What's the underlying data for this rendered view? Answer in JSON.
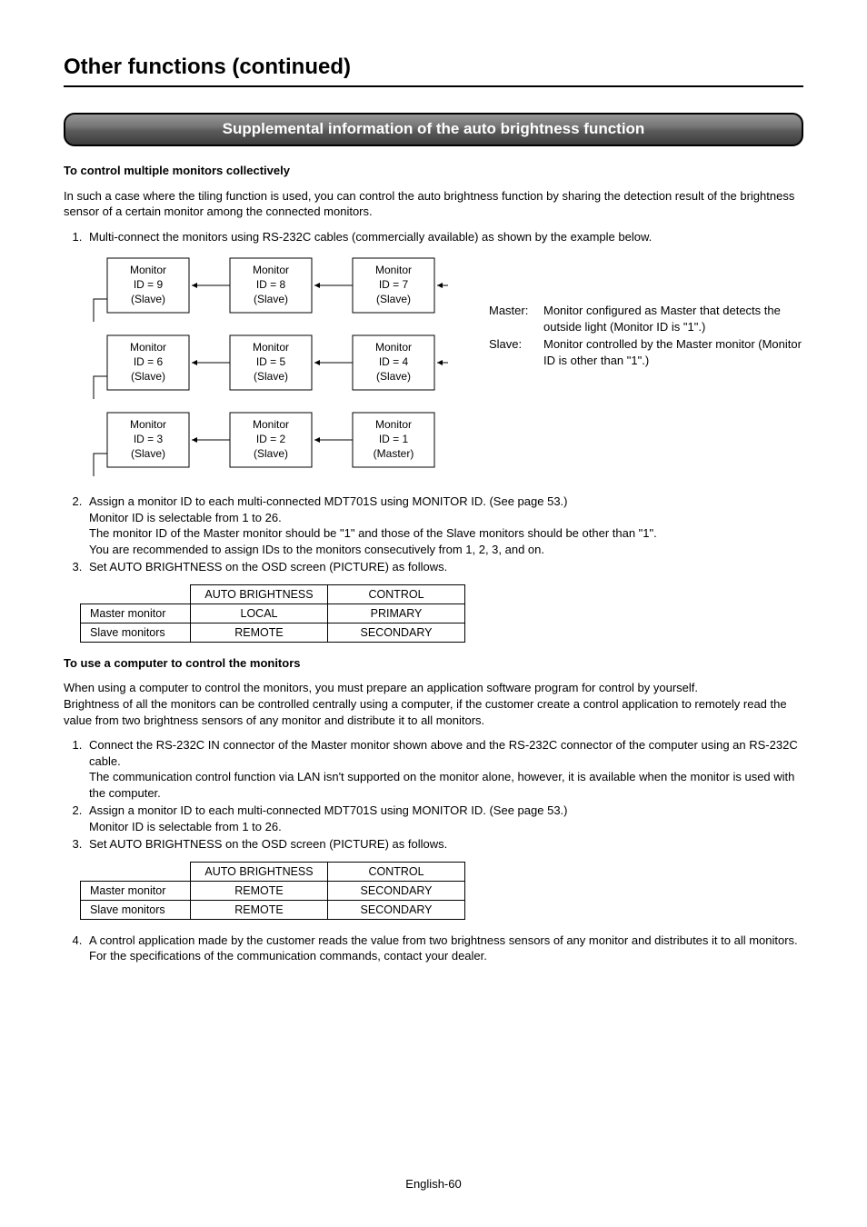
{
  "title": "Other functions (continued)",
  "banner": "Supplemental information of the auto brightness function",
  "sec1": {
    "heading": "To control multiple monitors collectively",
    "intro": "In such a case where the tiling function is used, you can control the auto brightness function by sharing the detection result of the brightness sensor of a certain monitor among the connected monitors.",
    "step1": "Multi-connect the monitors using RS-232C cables (commercially available) as shown by the example below.",
    "step2a": "Assign a monitor ID to each multi-connected MDT701S using MONITOR ID. (See page 53.)",
    "step2b": "Monitor ID is selectable from 1 to 26.",
    "step2c": "The monitor ID of the Master monitor should be \"1\" and those of the Slave monitors should be other than \"1\".",
    "step2d": "You are recommended to assign IDs to the monitors consecutively from 1, 2, 3, and on.",
    "step3": "Set AUTO BRIGHTNESS on the OSD screen (PICTURE) as follows."
  },
  "defs": {
    "master_label": "Master:",
    "master_text": "Monitor configured as Master that detects the outside light (Monitor ID is \"1\".)",
    "slave_label": "Slave:",
    "slave_text": "Monitor controlled by the Master monitor (Monitor ID is other than \"1\".)"
  },
  "diagram": {
    "boxes": [
      {
        "l1": "Monitor",
        "l2": "ID = 9",
        "l3": "(Slave)"
      },
      {
        "l1": "Monitor",
        "l2": "ID = 8",
        "l3": "(Slave)"
      },
      {
        "l1": "Monitor",
        "l2": "ID = 7",
        "l3": "(Slave)"
      },
      {
        "l1": "Monitor",
        "l2": "ID = 6",
        "l3": "(Slave)"
      },
      {
        "l1": "Monitor",
        "l2": "ID = 5",
        "l3": "(Slave)"
      },
      {
        "l1": "Monitor",
        "l2": "ID = 4",
        "l3": "(Slave)"
      },
      {
        "l1": "Monitor",
        "l2": "ID = 3",
        "l3": "(Slave)"
      },
      {
        "l1": "Monitor",
        "l2": "ID = 2",
        "l3": "(Slave)"
      },
      {
        "l1": "Monitor",
        "l2": "ID = 1",
        "l3": "(Master)"
      }
    ]
  },
  "table1": {
    "h1": "AUTO BRIGHTNESS",
    "h2": "CONTROL",
    "r1": "Master monitor",
    "r1c1": "LOCAL",
    "r1c2": "PRIMARY",
    "r2": "Slave monitors",
    "r2c1": "REMOTE",
    "r2c2": "SECONDARY"
  },
  "sec2": {
    "heading": "To use a computer to control the monitors",
    "p1": "When using a computer to control the monitors, you must prepare an application software program for control by yourself.",
    "p2": "Brightness of all the monitors can be controlled centrally using a computer, if the customer create a control application to remotely read the value from two brightness sensors of any monitor and distribute it to all monitors.",
    "step1a": "Connect the RS-232C IN connector of the Master monitor shown above and the RS-232C connector of the computer using an RS-232C cable.",
    "step1b": "The communication control function via LAN isn't supported on the monitor alone, however, it is available when the monitor is used with the computer.",
    "step2a": "Assign a monitor ID to each multi-connected MDT701S using MONITOR ID. (See page 53.)",
    "step2b": "Monitor ID is selectable from 1 to 26.",
    "step3": "Set AUTO BRIGHTNESS on the OSD screen (PICTURE) as follows.",
    "step4": "A control application made by the customer reads the value from two brightness sensors of any monitor and distributes it to all monitors. For the specifications of the communication commands, contact your dealer."
  },
  "table2": {
    "h1": "AUTO BRIGHTNESS",
    "h2": "CONTROL",
    "r1": "Master monitor",
    "r1c1": "REMOTE",
    "r1c2": "SECONDARY",
    "r2": "Slave monitors",
    "r2c1": "REMOTE",
    "r2c2": "SECONDARY"
  },
  "pagenum": "English-60"
}
